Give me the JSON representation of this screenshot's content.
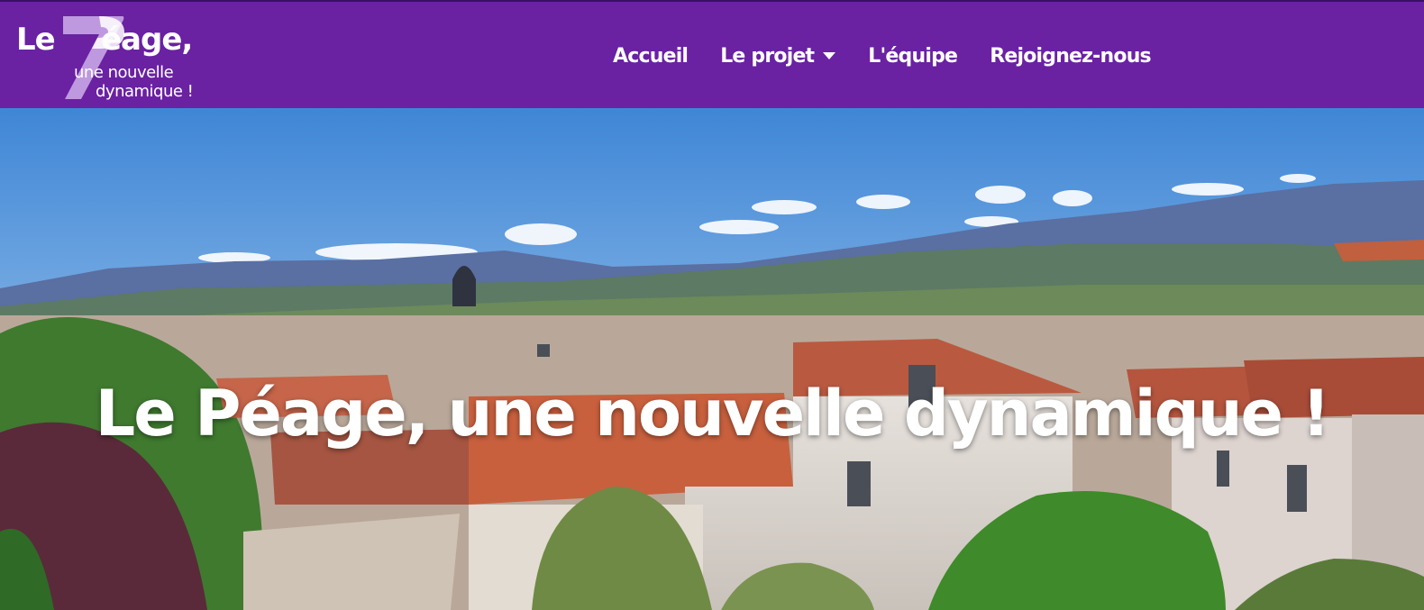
{
  "brand": {
    "logo_line1_le": "Le",
    "logo_line1_rest": "éage,",
    "logo_line2": "une nouvelle",
    "logo_line3": "dynamique !",
    "logo_icon": "seven-shaped-p-logo"
  },
  "nav": {
    "items": [
      {
        "label": "Accueil",
        "dropdown": false
      },
      {
        "label": "Le projet",
        "dropdown": true
      },
      {
        "label": "L'équipe",
        "dropdown": false
      },
      {
        "label": "Rejoignez-nous",
        "dropdown": false
      }
    ]
  },
  "hero": {
    "title": "Le Péage, une nouvelle dynamique !"
  },
  "colors": {
    "navbar": "#6a21a2",
    "logo_accent": "#c9a6e6",
    "text": "#ffffff"
  }
}
